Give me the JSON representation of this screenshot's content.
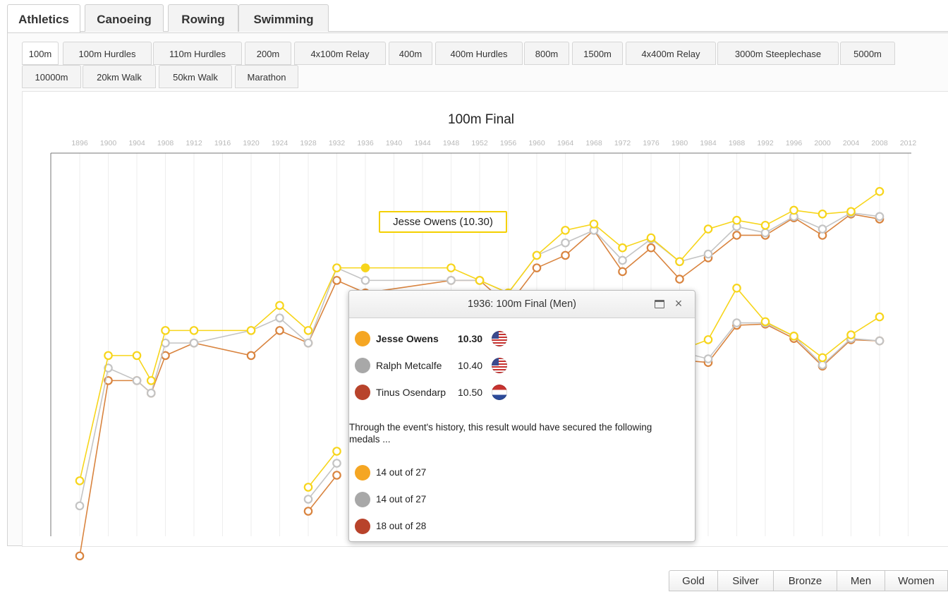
{
  "sport_tabs": [
    {
      "label": "Athletics",
      "active": true
    },
    {
      "label": "Canoeing",
      "active": false
    },
    {
      "label": "Rowing",
      "active": false
    },
    {
      "label": "Swimming",
      "active": false
    }
  ],
  "event_tabs_row1": [
    {
      "label": "100m",
      "active": true
    },
    {
      "label": "100m Hurdles"
    },
    {
      "label": "110m Hurdles"
    },
    {
      "label": "200m"
    },
    {
      "label": "4x100m Relay"
    },
    {
      "label": "400m"
    },
    {
      "label": "400m Hurdles"
    },
    {
      "label": "800m"
    },
    {
      "label": "1500m"
    },
    {
      "label": "4x400m Relay"
    },
    {
      "label": "3000m Steeplechase"
    },
    {
      "label": "5000m"
    }
  ],
  "event_tabs_row2": [
    {
      "label": "10000m"
    },
    {
      "label": "20km Walk"
    },
    {
      "label": "50km Walk"
    },
    {
      "label": "Marathon"
    }
  ],
  "colors": {
    "gold": "#f7d51b",
    "silver": "#c4c4c4",
    "bronze": "#d9843f",
    "gold_dot": "#f5a623",
    "silver_dot": "#a8a8a8",
    "bronze_dot": "#b8432b"
  },
  "chart_data": {
    "type": "line",
    "title": "100m Final",
    "x_axis_position": "top",
    "x_ticks": [
      1896,
      1900,
      1904,
      1908,
      1912,
      1916,
      1920,
      1924,
      1928,
      1932,
      1936,
      1940,
      1944,
      1948,
      1952,
      1956,
      1960,
      1964,
      1968,
      1972,
      1976,
      1980,
      1984,
      1988,
      1992,
      1996,
      2000,
      2004,
      2008,
      2012
    ],
    "y_scale": "relative performance (faster = higher), values estimated, no printed axis",
    "grid": true,
    "highlight": {
      "label": "Jesse Owens (10.30)",
      "year": 1936,
      "series": "Gold"
    },
    "series": [
      {
        "group": "Men",
        "medal": "Gold",
        "color": "#f7d51b",
        "points": [
          [
            1896,
            12.0
          ],
          [
            1900,
            11.0
          ],
          [
            1904,
            11.0
          ],
          [
            1906,
            11.2
          ],
          [
            1908,
            10.8
          ],
          [
            1912,
            10.8
          ],
          [
            1920,
            10.8
          ],
          [
            1924,
            10.6
          ],
          [
            1928,
            10.8
          ],
          [
            1932,
            10.3
          ],
          [
            1936,
            10.3
          ],
          [
            1948,
            10.3
          ],
          [
            1952,
            10.4
          ],
          [
            1956,
            10.5
          ],
          [
            1960,
            10.2
          ],
          [
            1964,
            10.0
          ],
          [
            1968,
            9.95
          ],
          [
            1972,
            10.14
          ],
          [
            1976,
            10.06
          ],
          [
            1980,
            10.25
          ],
          [
            1984,
            9.99
          ],
          [
            1988,
            9.92
          ],
          [
            1992,
            9.96
          ],
          [
            1996,
            9.84
          ],
          [
            2000,
            9.87
          ],
          [
            2004,
            9.85
          ],
          [
            2008,
            9.69
          ]
        ]
      },
      {
        "group": "Men",
        "medal": "Silver",
        "color": "#c4c4c4",
        "points": [
          [
            1896,
            12.2
          ],
          [
            1900,
            11.1
          ],
          [
            1904,
            11.2
          ],
          [
            1906,
            11.3
          ],
          [
            1908,
            10.9
          ],
          [
            1912,
            10.9
          ],
          [
            1920,
            10.8
          ],
          [
            1924,
            10.7
          ],
          [
            1928,
            10.9
          ],
          [
            1932,
            10.3
          ],
          [
            1936,
            10.4
          ],
          [
            1948,
            10.4
          ],
          [
            1952,
            10.4
          ],
          [
            1956,
            10.5
          ],
          [
            1960,
            10.2
          ],
          [
            1964,
            10.1
          ],
          [
            1968,
            10.0
          ],
          [
            1972,
            10.24
          ],
          [
            1976,
            10.07
          ],
          [
            1980,
            10.25
          ],
          [
            1984,
            10.19
          ],
          [
            1988,
            9.97
          ],
          [
            1992,
            10.02
          ],
          [
            1996,
            9.89
          ],
          [
            2000,
            9.99
          ],
          [
            2004,
            9.86
          ],
          [
            2008,
            9.89
          ]
        ]
      },
      {
        "group": "Men",
        "medal": "Bronze",
        "color": "#d9843f",
        "points": [
          [
            1896,
            12.6
          ],
          [
            1900,
            11.2
          ],
          [
            1904,
            11.2
          ],
          [
            1906,
            11.3
          ],
          [
            1908,
            11.0
          ],
          [
            1912,
            10.9
          ],
          [
            1920,
            11.0
          ],
          [
            1924,
            10.8
          ],
          [
            1928,
            10.9
          ],
          [
            1932,
            10.4
          ],
          [
            1936,
            10.5
          ],
          [
            1948,
            10.4
          ],
          [
            1952,
            10.4
          ],
          [
            1956,
            10.6
          ],
          [
            1960,
            10.3
          ],
          [
            1964,
            10.2
          ],
          [
            1968,
            10.0
          ],
          [
            1972,
            10.33
          ],
          [
            1976,
            10.14
          ],
          [
            1980,
            10.39
          ],
          [
            1984,
            10.22
          ],
          [
            1988,
            10.04
          ],
          [
            1992,
            10.04
          ],
          [
            1996,
            9.9
          ],
          [
            2000,
            10.04
          ],
          [
            2004,
            9.87
          ],
          [
            2008,
            9.91
          ]
        ]
      },
      {
        "group": "Women",
        "medal": "Gold",
        "color": "#f7d51b",
        "points": [
          [
            1928,
            12.2
          ],
          [
            1932,
            11.9
          ],
          [
            1980,
            11.06
          ],
          [
            1984,
            10.97
          ],
          [
            1988,
            10.54
          ],
          [
            1992,
            10.82
          ],
          [
            1996,
            10.94
          ],
          [
            2000,
            11.12
          ],
          [
            2004,
            10.93
          ],
          [
            2008,
            10.78
          ]
        ]
      },
      {
        "group": "Women",
        "medal": "Silver",
        "color": "#c4c4c4",
        "points": [
          [
            1928,
            12.3
          ],
          [
            1932,
            12.0
          ],
          [
            1980,
            11.07
          ],
          [
            1984,
            11.13
          ],
          [
            1988,
            10.83
          ],
          [
            1992,
            10.83
          ],
          [
            1996,
            10.94
          ],
          [
            2000,
            11.18
          ],
          [
            2004,
            10.96
          ],
          [
            2008,
            10.98
          ]
        ]
      },
      {
        "group": "Women",
        "medal": "Bronze",
        "color": "#d9843f",
        "points": [
          [
            1928,
            12.4
          ],
          [
            1932,
            12.1
          ],
          [
            1980,
            11.14
          ],
          [
            1984,
            11.16
          ],
          [
            1988,
            10.85
          ],
          [
            1992,
            10.84
          ],
          [
            1996,
            10.96
          ],
          [
            2000,
            11.19
          ],
          [
            2004,
            10.97
          ],
          [
            2008,
            10.98
          ]
        ]
      }
    ]
  },
  "popup": {
    "title": "1936: 100m Final (Men)",
    "medalists": [
      {
        "medal": "Gold",
        "name": "Jesse Owens",
        "time": "10.30",
        "country": "USA"
      },
      {
        "medal": "Silver",
        "name": "Ralph Metcalfe",
        "time": "10.40",
        "country": "USA"
      },
      {
        "medal": "Bronze",
        "name": "Tinus Osendarp",
        "time": "10.50",
        "country": "Netherlands"
      }
    ],
    "history_text": "Through the event's history, this result would have secured the following medals ...",
    "tallies": [
      {
        "medal": "Gold",
        "text": "14 out of 27"
      },
      {
        "medal": "Silver",
        "text": "14 out of 27"
      },
      {
        "medal": "Bronze",
        "text": "18 out of 28"
      }
    ]
  },
  "filter_buttons": [
    {
      "label": "Gold"
    },
    {
      "label": "Silver"
    },
    {
      "label": "Bronze"
    },
    {
      "label": "Men"
    },
    {
      "label": "Women"
    }
  ]
}
